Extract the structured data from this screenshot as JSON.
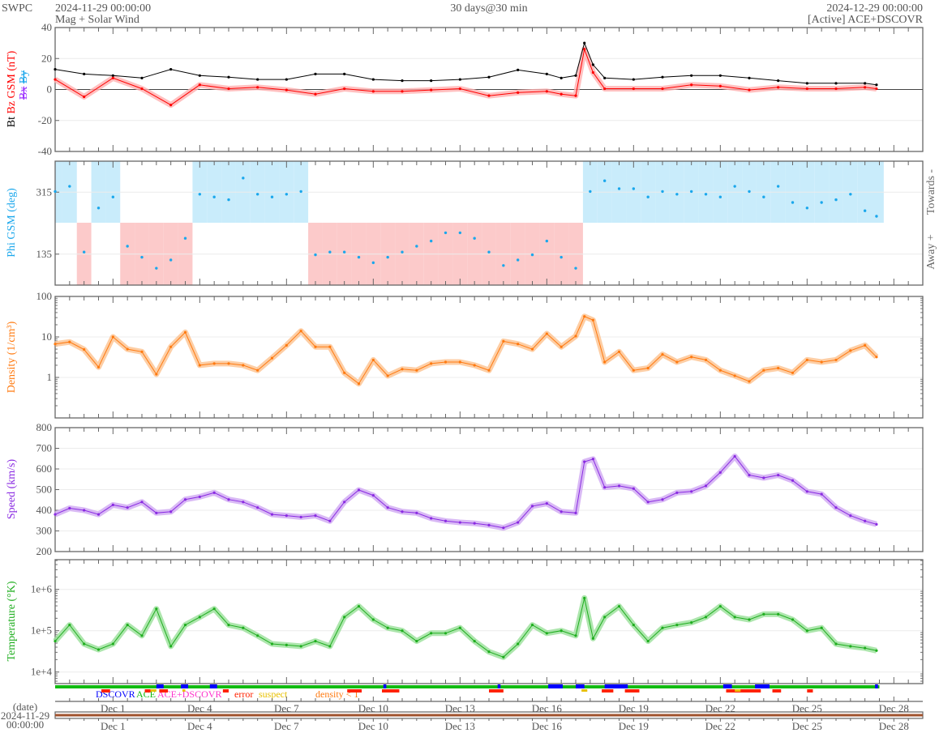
{
  "header": {
    "agency": "SWPC",
    "start_time": "2024-11-29 00:00:00",
    "subtitle": "Mag + Solar Wind",
    "span": "30 days@30 min",
    "end_time": "2024-12-29 00:00:00",
    "source": "[Active] ACE+DSCOVR"
  },
  "colors": {
    "bt": "#000000",
    "bz": "#ff0000",
    "bx": "#9b30ff",
    "by": "#1aa7ec",
    "phi": "#1aa7ec",
    "towards_bg": "#c9ecfb",
    "away_bg": "#fccaca",
    "density": "#ff7a10",
    "density_band": "#fdc28f",
    "speed": "#8a2be2",
    "speed_band": "#cfa8f2",
    "temperature": "#1fae1f",
    "temperature_band": "#98e098",
    "dscovr": "#0000ff",
    "ace": "#11bb11",
    "ace_dscovr": "#ff33cc",
    "error": "#ff2200",
    "suspect": "#e8c000",
    "density_lt1": "#ff7a10"
  },
  "chart_data": [
    {
      "type": "line",
      "panel": "mag",
      "ylabel_parts": [
        "Bt",
        "Bz GSM (nT)",
        "Bx",
        "By"
      ],
      "ylim": [
        -40,
        40
      ],
      "yticks": [
        "40",
        "20",
        "0",
        "-20",
        "-40"
      ],
      "ytick_values": [
        40,
        20,
        0,
        -20,
        -40
      ],
      "x_days": [
        0,
        1,
        2,
        3,
        4,
        5,
        6,
        7,
        8,
        9,
        10,
        11,
        12,
        13,
        14,
        15,
        16,
        17,
        17.5,
        18,
        18.3,
        18.6,
        19,
        20,
        21,
        22,
        23,
        24,
        25,
        26,
        27,
        28,
        28.4
      ],
      "series": [
        {
          "name": "Bt",
          "values": [
            13,
            10,
            9,
            7.4,
            13,
            9,
            8,
            6.5,
            6.5,
            10,
            10,
            6.5,
            5.7,
            5.7,
            6.5,
            8,
            12.6,
            10,
            7.4,
            9,
            30,
            16,
            7.4,
            6.5,
            8,
            9,
            9,
            7.4,
            5.7,
            4,
            4,
            4,
            3
          ]
        },
        {
          "name": "Bz",
          "values": [
            6.5,
            -4.7,
            7.4,
            0.5,
            -10,
            3,
            0.5,
            1.4,
            -0.3,
            -3,
            0.5,
            -1.2,
            -1.2,
            -0.3,
            0.5,
            -4,
            -2,
            -1.2,
            -3,
            -4,
            26,
            11,
            0.5,
            0.5,
            0.5,
            3,
            2.2,
            -0.3,
            1.4,
            0.5,
            0.5,
            1.4,
            0.5
          ]
        }
      ]
    },
    {
      "type": "scatter",
      "panel": "phi",
      "ylabel": "Phi GSM (deg)",
      "ylim": [
        45,
        405
      ],
      "yticks": [
        "315",
        "135"
      ],
      "ytick_values": [
        315,
        135
      ],
      "right_labels": [
        "Towards -",
        "Away +"
      ],
      "sector_boundary": 225,
      "x_days": [
        0,
        0.5,
        1,
        1.5,
        2,
        2.5,
        3,
        3.5,
        4,
        4.5,
        5,
        5.5,
        6,
        6.5,
        7,
        7.5,
        8,
        8.5,
        9,
        9.5,
        10,
        10.5,
        11,
        11.5,
        12,
        12.5,
        13,
        13.5,
        14,
        14.5,
        15,
        15.5,
        16,
        16.5,
        17,
        17.5,
        18,
        18.5,
        19,
        19.5,
        20,
        20.5,
        21,
        21.5,
        22,
        22.5,
        23,
        23.5,
        24,
        24.5,
        25,
        25.5,
        26,
        26.5,
        27,
        27.5,
        28,
        28.4
      ],
      "values": [
        317,
        332,
        141,
        269,
        301,
        158,
        126,
        94,
        118,
        181,
        309,
        301,
        293,
        356,
        309,
        301,
        309,
        317,
        133,
        141,
        141,
        126,
        110,
        126,
        141,
        158,
        173,
        197,
        197,
        181,
        141,
        102,
        118,
        133,
        173,
        126,
        94,
        317,
        348,
        325,
        325,
        301,
        317,
        309,
        317,
        309,
        301,
        332,
        317,
        301,
        332,
        285,
        269,
        285,
        293,
        309,
        261,
        245
      ]
    },
    {
      "type": "line",
      "panel": "density",
      "ylabel": "Density (1/cm³)",
      "yscale": "log",
      "ylim": [
        0.1,
        100
      ],
      "yticks": [
        "100",
        "10",
        "1"
      ],
      "ytick_values": [
        100,
        10,
        1
      ],
      "x_days": [
        0,
        0.5,
        1,
        1.5,
        2,
        2.5,
        3,
        3.5,
        4,
        4.5,
        5,
        5.5,
        6,
        6.5,
        7,
        7.5,
        8,
        8.5,
        9,
        9.5,
        10,
        10.5,
        11,
        11.5,
        12,
        12.5,
        13,
        13.5,
        14,
        14.5,
        15,
        15.5,
        16,
        16.5,
        17,
        17.5,
        18,
        18.3,
        18.6,
        19,
        19.5,
        20,
        20.5,
        21,
        21.5,
        22,
        22.5,
        23,
        23.5,
        24,
        24.5,
        25,
        25.5,
        26,
        26.5,
        27,
        27.5,
        28,
        28.4
      ],
      "values": [
        6.7,
        7.5,
        4.9,
        1.8,
        10,
        5,
        4.3,
        1.2,
        5.7,
        13,
        2.0,
        2.2,
        2.2,
        2.0,
        1.5,
        3,
        6.2,
        14,
        5.7,
        5.7,
        1.3,
        0.7,
        2.7,
        1.1,
        1.6,
        1.5,
        2.2,
        2.4,
        2.4,
        2.0,
        1.5,
        7.8,
        6.7,
        5.0,
        12,
        5.7,
        10.5,
        32,
        26,
        2.4,
        4.3,
        1.5,
        1.7,
        3.7,
        2.4,
        3.2,
        2.7,
        1.5,
        1.1,
        0.8,
        1.5,
        1.7,
        1.3,
        2.7,
        2.4,
        2.7,
        4.6,
        6.2,
        3.2
      ]
    },
    {
      "type": "line",
      "panel": "speed",
      "ylabel": "Speed (km/s)",
      "ylim": [
        200,
        800
      ],
      "yticks": [
        "800",
        "700",
        "600",
        "500",
        "400",
        "300",
        "200"
      ],
      "ytick_values": [
        800,
        700,
        600,
        500,
        400,
        300,
        200
      ],
      "x_days": [
        0,
        0.5,
        1,
        1.5,
        2,
        2.5,
        3,
        3.5,
        4,
        4.5,
        5,
        5.5,
        6,
        6.5,
        7,
        7.5,
        8,
        8.5,
        9,
        9.5,
        10,
        10.5,
        11,
        11.5,
        12,
        12.5,
        13,
        13.5,
        14,
        14.5,
        15,
        15.5,
        16,
        16.5,
        17,
        17.5,
        18,
        18.3,
        18.6,
        19,
        19.5,
        20,
        20.5,
        21,
        21.5,
        22,
        22.5,
        23,
        23.5,
        24,
        24.5,
        25,
        25.5,
        26,
        26.5,
        27,
        27.5,
        28,
        28.4
      ],
      "values": [
        380,
        410,
        400,
        380,
        426,
        413,
        440,
        387,
        393,
        452,
        465,
        485,
        452,
        440,
        413,
        380,
        374,
        367,
        374,
        348,
        440,
        498,
        472,
        413,
        393,
        387,
        361,
        348,
        341,
        337,
        328,
        315,
        341,
        420,
        433,
        393,
        387,
        635,
        648,
        511,
        518,
        505,
        440,
        452,
        485,
        491,
        518,
        583,
        661,
        570,
        557,
        570,
        544,
        491,
        478,
        413,
        374,
        348,
        332
      ]
    },
    {
      "type": "line",
      "panel": "temperature",
      "ylabel": "Temperature (°K)",
      "yscale": "log",
      "ylim": [
        5250,
        5250000
      ],
      "yticks": [
        "1e+6",
        "1e+5",
        "1e+4"
      ],
      "ytick_values": [
        1000000,
        100000,
        10000
      ],
      "x_days": [
        0,
        0.5,
        1,
        1.5,
        2,
        2.5,
        3,
        3.5,
        4,
        4.5,
        5,
        5.5,
        6,
        6.5,
        7,
        7.5,
        8,
        8.5,
        9,
        9.5,
        10,
        10.5,
        11,
        11.5,
        12,
        12.5,
        13,
        13.5,
        14,
        14.5,
        15,
        15.5,
        16,
        16.5,
        17,
        17.5,
        18,
        18.3,
        18.6,
        19,
        19.5,
        20,
        20.5,
        21,
        21.5,
        22,
        22.5,
        23,
        23.5,
        24,
        24.5,
        25,
        25.5,
        26,
        26.5,
        27,
        27.5,
        28,
        28.4
      ],
      "values": [
        56000,
        138000,
        48000,
        35000,
        48000,
        138000,
        76000,
        339000,
        42000,
        138000,
        214000,
        339000,
        138000,
        117000,
        76000,
        48000,
        45000,
        42000,
        56000,
        42000,
        214000,
        389000,
        186000,
        117000,
        100000,
        56000,
        87000,
        87000,
        117000,
        56000,
        31000,
        23000,
        48000,
        138000,
        87000,
        100000,
        76000,
        617000,
        65000,
        214000,
        389000,
        138000,
        56000,
        117000,
        138000,
        158000,
        214000,
        389000,
        214000,
        186000,
        251000,
        251000,
        186000,
        100000,
        117000,
        48000,
        42000,
        38000,
        33000
      ]
    }
  ],
  "status": {
    "legend": [
      "DSCOVR",
      "ACE",
      "ACE+DSCOVR",
      "error",
      "suspect",
      "density < 1"
    ],
    "dscovr_segments": [
      [
        3.5,
        3.75
      ],
      [
        4.35,
        4.6
      ],
      [
        5.35,
        5.6
      ],
      [
        11.35,
        11.45
      ],
      [
        15.3,
        15.4
      ],
      [
        17.05,
        17.55
      ],
      [
        18.0,
        18.3
      ],
      [
        19.0,
        19.8
      ],
      [
        23.1,
        23.4
      ],
      [
        24.2,
        24.7
      ],
      [
        28.35,
        28.45
      ]
    ],
    "error_segments": [
      [
        1.6,
        1.9
      ],
      [
        3.1,
        3.3
      ],
      [
        3.6,
        3.9
      ],
      [
        5.8,
        6.0
      ],
      [
        10.1,
        10.6
      ],
      [
        11.3,
        11.9
      ],
      [
        15.0,
        15.5
      ],
      [
        18.9,
        19.3
      ],
      [
        19.7,
        20.2
      ],
      [
        23.2,
        24.4
      ],
      [
        24.8,
        25.1
      ],
      [
        26.0,
        26.2
      ]
    ],
    "suspect_segments": [
      [
        3.3,
        3.5
      ],
      [
        4.4,
        4.5
      ],
      [
        18.2,
        18.4
      ],
      [
        23.5,
        23.7
      ]
    ]
  },
  "time_axis": {
    "labels": [
      "Dec 1",
      "Dec 4",
      "Dec 7",
      "Dec 10",
      "Dec 13",
      "Dec 16",
      "Dec 19",
      "Dec 22",
      "Dec 25",
      "Dec 28"
    ],
    "label_days": [
      2,
      5,
      8,
      11,
      14,
      17,
      20,
      23,
      26,
      29
    ],
    "caption": "(date)",
    "start_date": "2024-11-29",
    "start_clock": "00:00:00"
  }
}
